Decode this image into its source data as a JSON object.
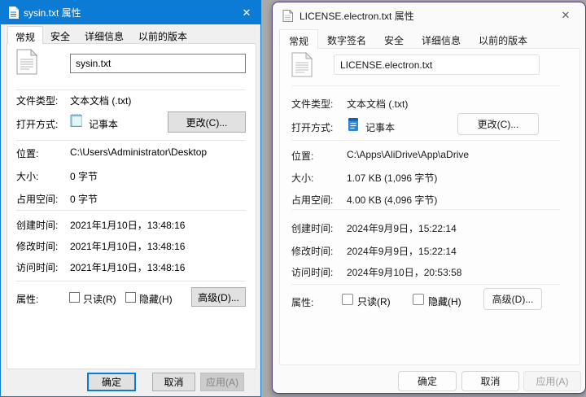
{
  "colors": {
    "left_titlebar": "#0b7bd6",
    "left_window_border": "#0c7cd5",
    "right_window_border": "#55407c",
    "focus_accent": "#0078d7",
    "desktop_background": "#a9a9a9"
  },
  "close_glyph": "✕",
  "left_dialog": {
    "title": "sysin.txt 属性",
    "tabs": [
      {
        "label": "常规"
      },
      {
        "label": "安全"
      },
      {
        "label": "详细信息"
      },
      {
        "label": "以前的版本"
      }
    ],
    "filename": "sysin.txt",
    "fields": {
      "type_label": "文件类型:",
      "type_value": "文本文档 (.txt)",
      "open_label": "打开方式:",
      "open_value": "记事本",
      "change_button": "更改(C)...",
      "location_label": "位置:",
      "location_value": "C:\\Users\\Administrator\\Desktop",
      "size_label": "大小:",
      "size_value": "0 字节",
      "disk_label": "占用空间:",
      "disk_value": "0 字节",
      "created_label": "创建时间:",
      "created_value": "2021年1月10日，13:48:16",
      "modified_label": "修改时间:",
      "modified_value": "2021年1月10日，13:48:16",
      "accessed_label": "访问时间:",
      "accessed_value": "2021年1月10日，13:48:16",
      "attr_label": "属性:",
      "readonly_label": "只读(R)",
      "hidden_label": "隐藏(H)",
      "advanced_button": "高级(D)..."
    },
    "buttons": {
      "ok": "确定",
      "cancel": "取消",
      "apply": "应用(A)"
    }
  },
  "right_dialog": {
    "title": "LICENSE.electron.txt 属性",
    "tabs": [
      {
        "label": "常规"
      },
      {
        "label": "数字签名"
      },
      {
        "label": "安全"
      },
      {
        "label": "详细信息"
      },
      {
        "label": "以前的版本"
      }
    ],
    "filename": "LICENSE.electron.txt",
    "fields": {
      "type_label": "文件类型:",
      "type_value": "文本文档 (.txt)",
      "open_label": "打开方式:",
      "open_value": "记事本",
      "change_button": "更改(C)...",
      "location_label": "位置:",
      "location_value": "C:\\Apps\\AliDrive\\App\\aDrive",
      "size_label": "大小:",
      "size_value": "1.07 KB (1,096 字节)",
      "disk_label": "占用空间:",
      "disk_value": "4.00 KB (4,096 字节)",
      "created_label": "创建时间:",
      "created_value": "2024年9月9日，15:22:14",
      "modified_label": "修改时间:",
      "modified_value": "2024年9月9日，15:22:14",
      "accessed_label": "访问时间:",
      "accessed_value": "2024年9月10日，20:53:58",
      "attr_label": "属性:",
      "readonly_label": "只读(R)",
      "hidden_label": "隐藏(H)",
      "advanced_button": "高级(D)..."
    },
    "buttons": {
      "ok": "确定",
      "cancel": "取消",
      "apply": "应用(A)"
    }
  }
}
